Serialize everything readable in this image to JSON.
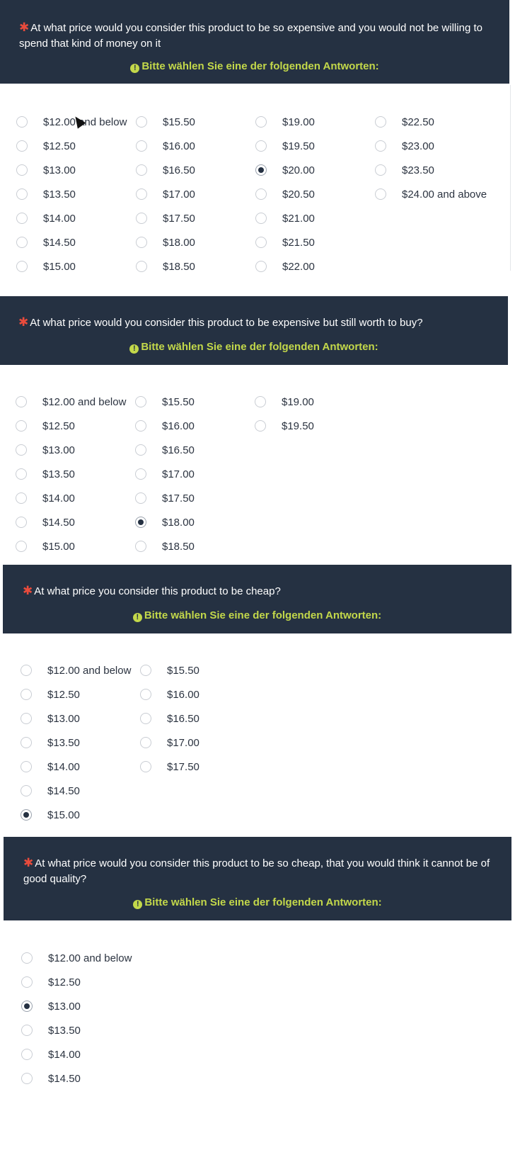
{
  "hint_text": "Bitte wählen Sie eine der folgenden Antworten:",
  "hint_icon": "exclamation-circle-icon",
  "required_icon": "asterisk-icon",
  "colors": {
    "header_bg": "#253142",
    "hint": "#c3d84a",
    "required": "#e94b3c"
  },
  "questions": [
    {
      "title": "At what price would you consider this product to be so expensive and you would not be willing to spend that kind of money on it",
      "options": [
        "$12.00 and below",
        "$12.50",
        "$13.00",
        "$13.50",
        "$14.00",
        "$14.50",
        "$15.00",
        "$15.50",
        "$16.00",
        "$16.50",
        "$17.00",
        "$17.50",
        "$18.00",
        "$18.50",
        "$19.00",
        "$19.50",
        "$20.00",
        "$20.50",
        "$21.00",
        "$21.50",
        "$22.00",
        "$22.50",
        "$23.00",
        "$23.50",
        "$24.00 and above"
      ],
      "selected": "$20.00"
    },
    {
      "title": "At what price would you consider this product to be expensive but still worth to buy?",
      "options": [
        "$12.00 and below",
        "$12.50",
        "$13.00",
        "$13.50",
        "$14.00",
        "$14.50",
        "$15.00",
        "$15.50",
        "$16.00",
        "$16.50",
        "$17.00",
        "$17.50",
        "$18.00",
        "$18.50",
        "$19.00",
        "$19.50"
      ],
      "selected": "$18.00"
    },
    {
      "title": "At what price you consider this product to be cheap?",
      "options": [
        "$12.00 and below",
        "$12.50",
        "$13.00",
        "$13.50",
        "$14.00",
        "$14.50",
        "$15.00",
        "$15.50",
        "$16.00",
        "$16.50",
        "$17.00",
        "$17.50"
      ],
      "selected": "$15.00"
    },
    {
      "title": "At what price would you consider this product to be so cheap, that you would think it cannot be of good quality?",
      "options": [
        "$12.00 and below",
        "$12.50",
        "$13.00",
        "$13.50",
        "$14.00",
        "$14.50"
      ],
      "selected": "$13.00"
    }
  ]
}
